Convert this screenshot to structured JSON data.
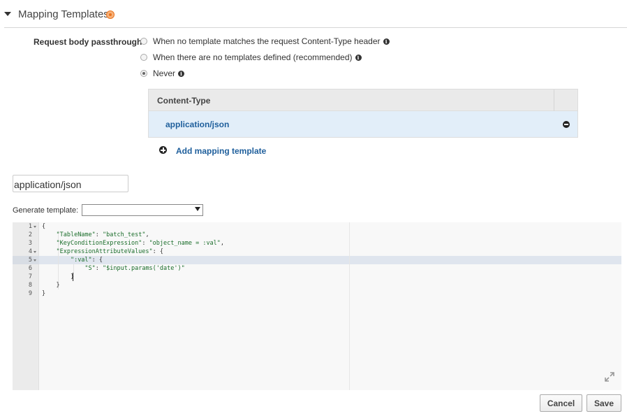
{
  "section": {
    "title": "Mapping Templates"
  },
  "passthrough": {
    "label": "Request body passthrough",
    "options": [
      {
        "label": "When no template matches the request Content-Type header",
        "selected": false
      },
      {
        "label": "When there are no templates defined (recommended)",
        "selected": false
      },
      {
        "label": "Never",
        "selected": true
      }
    ]
  },
  "content_types": {
    "header": "Content-Type",
    "rows": [
      {
        "label": "application/json"
      }
    ],
    "add_label": "Add mapping template"
  },
  "content_type_input": {
    "value": "application/json"
  },
  "generate": {
    "label": "Generate template:",
    "selected": ""
  },
  "editor": {
    "lines": [
      {
        "num": "1",
        "fold": true
      },
      {
        "num": "2",
        "fold": false
      },
      {
        "num": "3",
        "fold": false
      },
      {
        "num": "4",
        "fold": true
      },
      {
        "num": "5",
        "fold": true
      },
      {
        "num": "6",
        "fold": false
      },
      {
        "num": "7",
        "fold": false
      },
      {
        "num": "8",
        "fold": false
      },
      {
        "num": "9",
        "fold": false
      }
    ],
    "code": {
      "l1": "{",
      "l2_key": "\"TableName\"",
      "l2_val": "\"batch_test\"",
      "l3_key": "\"KeyConditionExpression\"",
      "l3_val": "\"object_name = :val\"",
      "l4_key": "\"ExpressionAttributeValues\"",
      "l5_key": "\":val\"",
      "l6_key": "\"S\"",
      "l6_val": "\"$input.params('date')\"",
      "l7": "}",
      "l8": "}",
      "l9": "}"
    }
  },
  "buttons": {
    "cancel": "Cancel",
    "save": "Save"
  },
  "colors": {
    "accent": "#1f5f9c",
    "selected_row": "#e2eef9",
    "status": "#e9731f"
  }
}
